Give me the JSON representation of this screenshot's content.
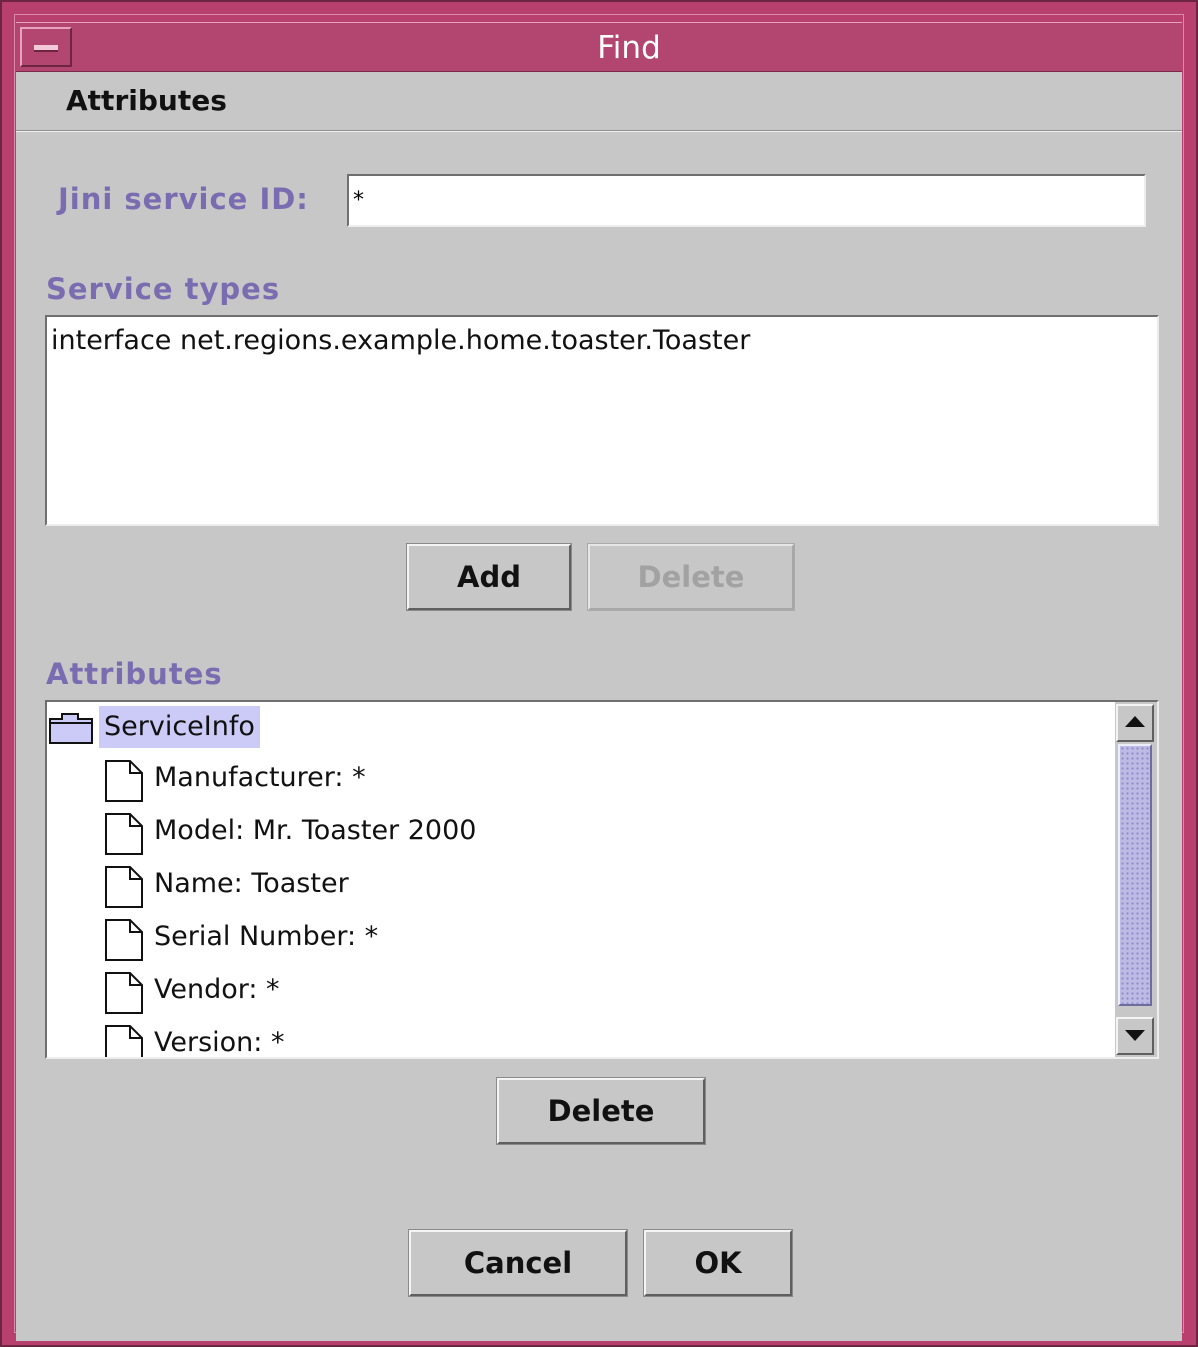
{
  "window": {
    "title": "Find"
  },
  "tab": {
    "label": "Attributes"
  },
  "jini": {
    "label": "Jini service ID:",
    "value": "*"
  },
  "service_types": {
    "label": "Service types",
    "items": [
      "interface net.regions.example.home.toaster.Toaster"
    ],
    "add_label": "Add",
    "delete_label": "Delete"
  },
  "attributes": {
    "label": "Attributes",
    "root": "ServiceInfo",
    "entries": [
      "Manufacturer: *",
      "Model: Mr. Toaster 2000",
      "Name: Toaster",
      "Serial Number: *",
      "Vendor: *",
      "Version: *"
    ],
    "delete_label": "Delete"
  },
  "footer": {
    "cancel_label": "Cancel",
    "ok_label": "OK"
  },
  "colors": {
    "titlebar": "#b34670",
    "label_purple": "#7a6cb0",
    "selection": "#cccbf7"
  }
}
